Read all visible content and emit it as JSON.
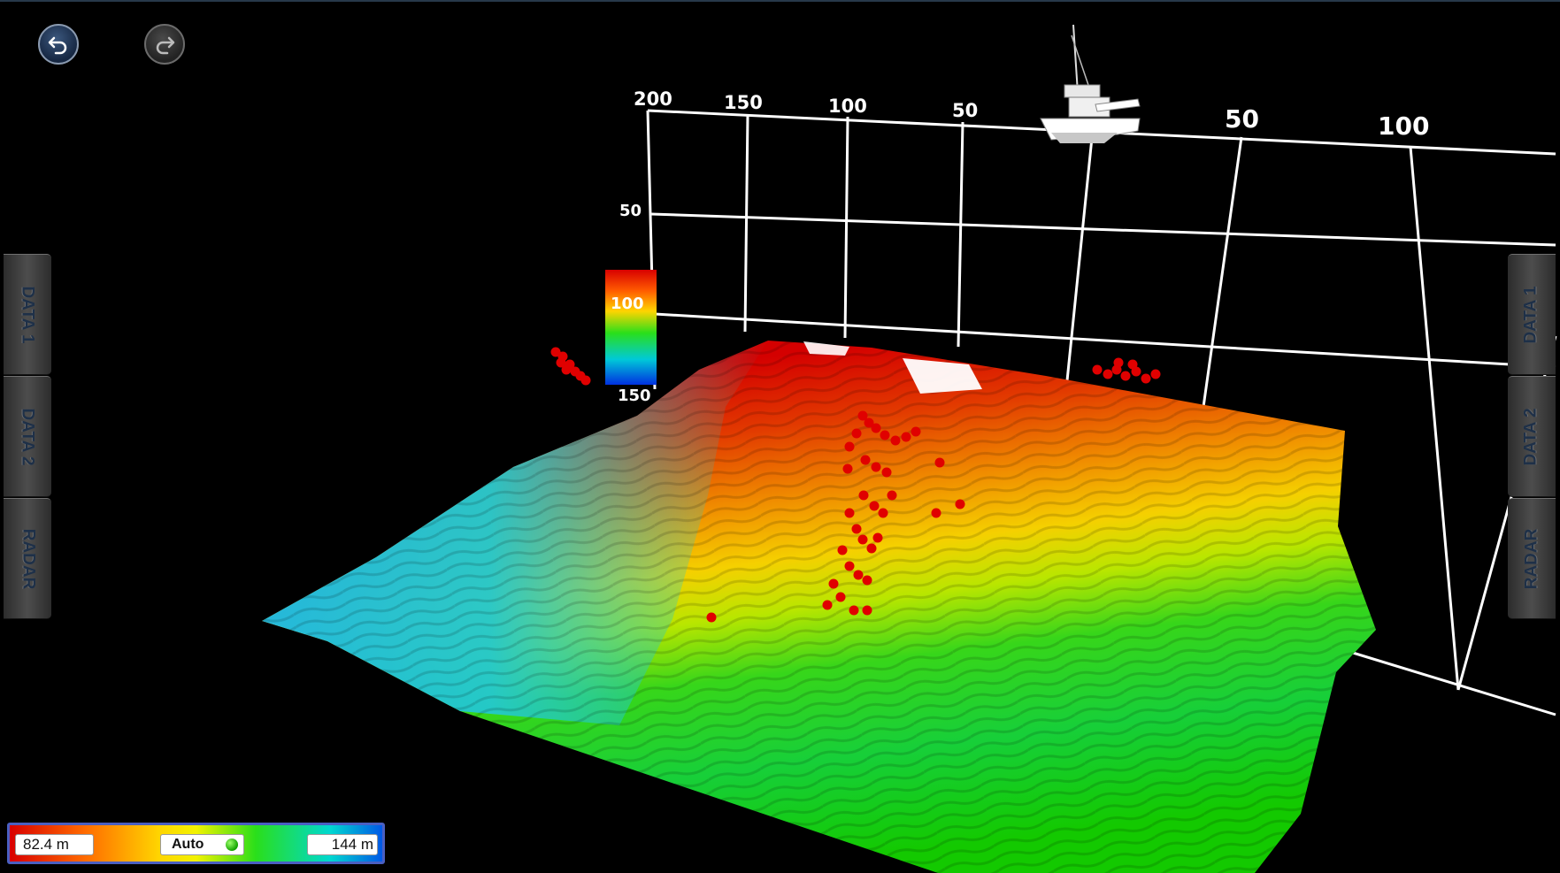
{
  "toolbar": {
    "undo_icon": "undo-icon",
    "redo_icon": "redo-icon"
  },
  "left_tabs": [
    "DATA 1",
    "DATA 2",
    "RADAR"
  ],
  "right_tabs": [
    "DATA 1",
    "DATA 2",
    "RADAR"
  ],
  "grid": {
    "port_labels": [
      "200",
      "150",
      "100",
      "50"
    ],
    "starboard_labels": [
      "50",
      "100"
    ],
    "depth_labels": [
      "50",
      "100",
      "150"
    ]
  },
  "depth_scale": {
    "min_label": "82.4 m",
    "mode_label": "Auto",
    "max_label": "144 m",
    "colors": [
      "#d80000",
      "#ff6a00",
      "#ffd400",
      "#f2f200",
      "#2adf1a",
      "#00d8d0",
      "#0058e6"
    ]
  },
  "icons": {
    "vessel": "boat-icon",
    "fish_targets": "fish-target-icon"
  }
}
